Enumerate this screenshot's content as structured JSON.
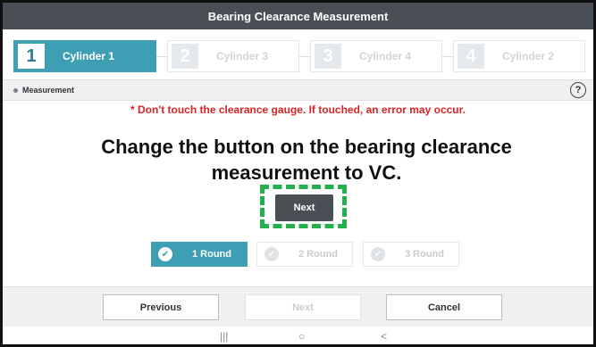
{
  "title": "Bearing Clearance Measurement",
  "steps": [
    {
      "num": "1",
      "label": "Cylinder 1",
      "state": "active"
    },
    {
      "num": "2",
      "label": "Cylinder 3",
      "state": "inactive"
    },
    {
      "num": "3",
      "label": "Cylinder 4",
      "state": "inactive"
    },
    {
      "num": "4",
      "label": "Cylinder 2",
      "state": "inactive"
    }
  ],
  "section": {
    "label": "Measurement",
    "help": "?"
  },
  "warning": "* Don't touch the clearance gauge. If touched, an error may occur.",
  "instruction": "Change the button on the bearing clearance measurement to VC.",
  "next_label": "Next",
  "rounds": [
    {
      "label": "1 Round",
      "state": "active"
    },
    {
      "label": "2 Round",
      "state": "inactive"
    },
    {
      "label": "3 Round",
      "state": "inactive"
    }
  ],
  "footer": {
    "previous": "Previous",
    "next": "Next",
    "cancel": "Cancel"
  },
  "navbar": {
    "recents": "|||",
    "home": "○",
    "back": "<"
  },
  "colors": {
    "accent": "#3e9fb4",
    "title_bar": "#4a4f56",
    "warning": "#d82424",
    "highlight": "#22b14c"
  }
}
